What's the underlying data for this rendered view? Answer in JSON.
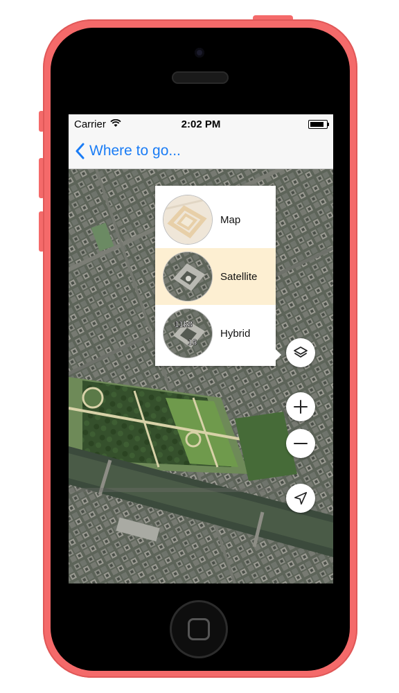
{
  "status_bar": {
    "carrier": "Carrier",
    "time": "2:02 PM"
  },
  "nav": {
    "back_label": "Where to go..."
  },
  "layers": {
    "options": [
      {
        "label": "Map",
        "selected": false
      },
      {
        "label": "Satellite",
        "selected": true
      },
      {
        "label": "Hybrid",
        "selected": false
      }
    ],
    "hybrid_thumb_labels": [
      "11k8",
      "16"
    ]
  },
  "colors": {
    "accent": "#1a7cf5",
    "phone": "#f46a6a",
    "selected_row": "#fdefd2"
  },
  "icons": [
    "wifi-icon",
    "battery-icon",
    "back-chevron-icon",
    "layers-icon",
    "zoom-in-icon",
    "zoom-out-icon",
    "location-arrow-icon"
  ]
}
